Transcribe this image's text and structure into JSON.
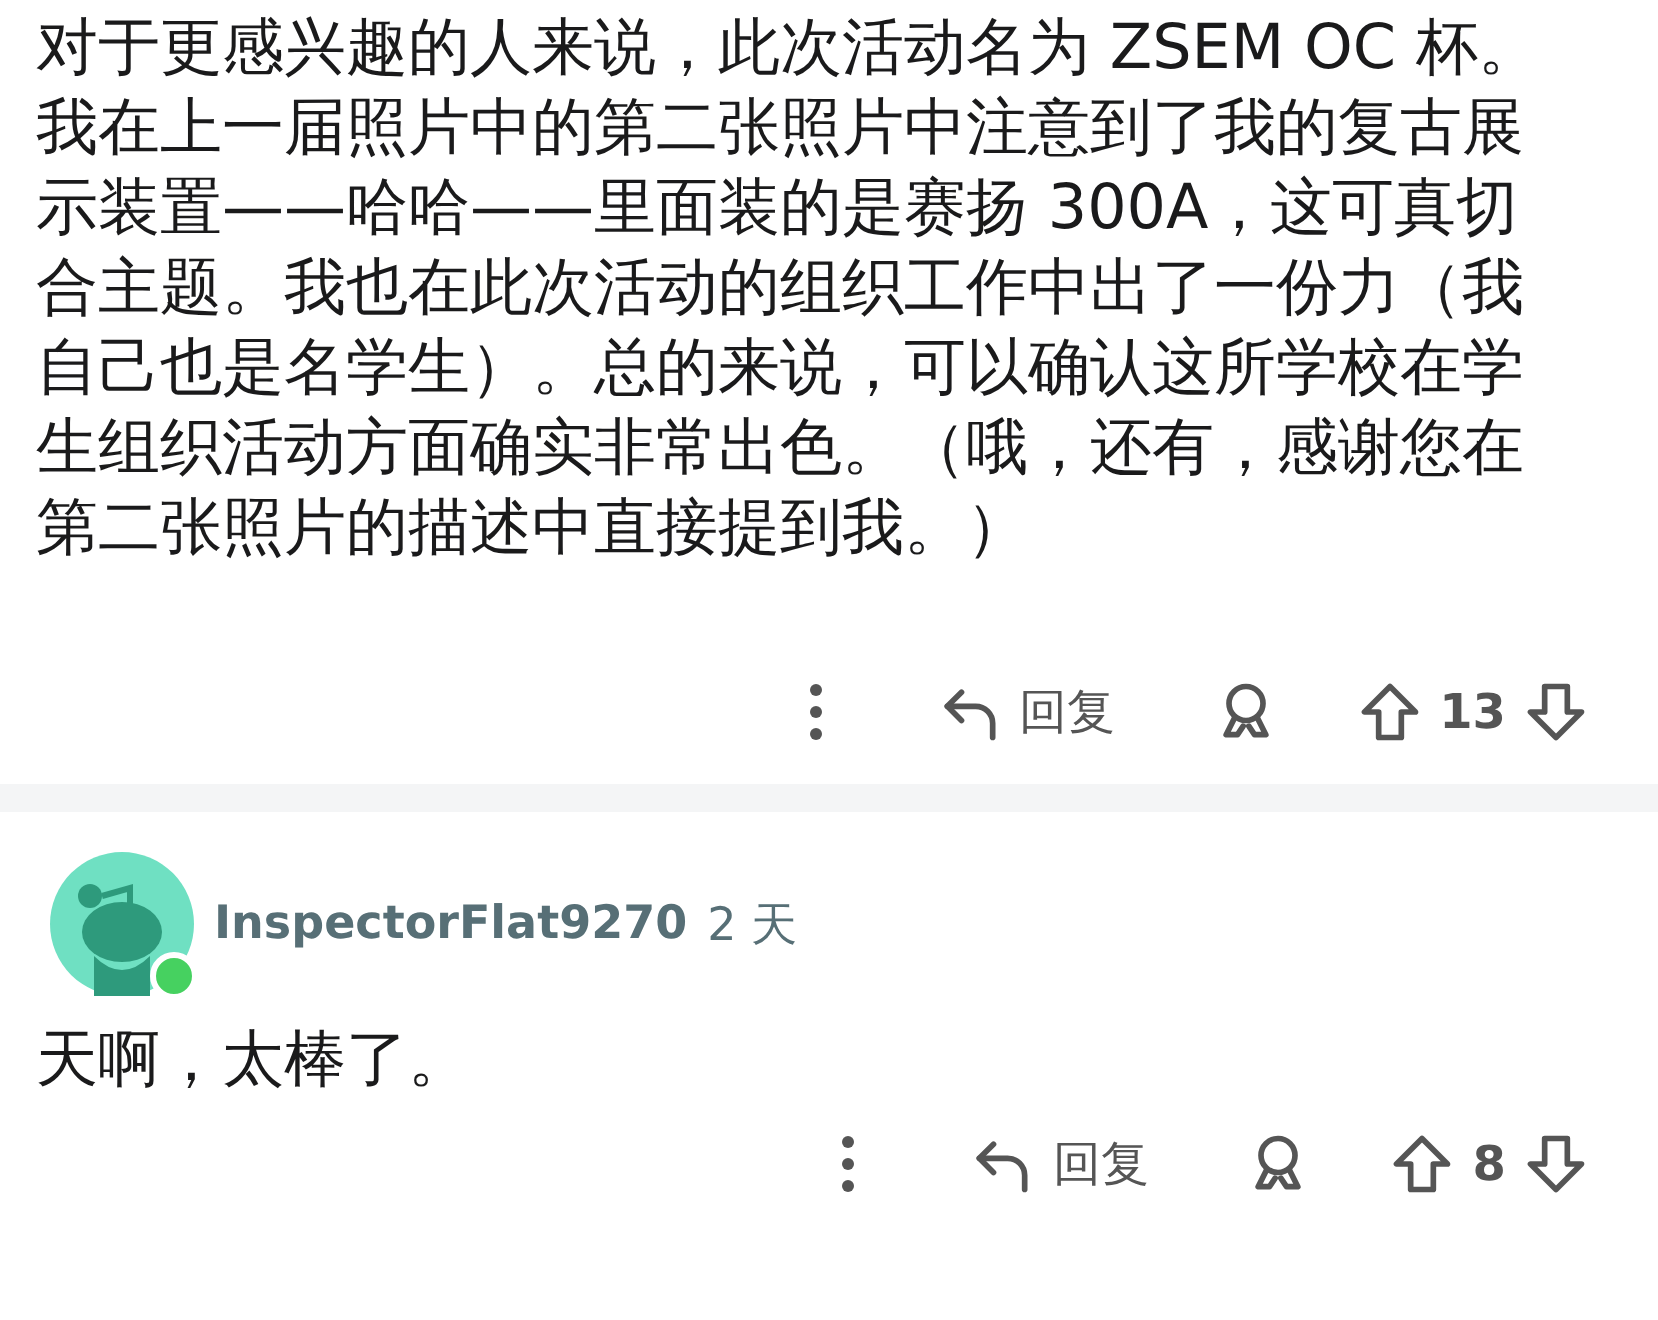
{
  "comments": [
    {
      "body": "对于更感兴趣的人来说，此次活动名为 ZSEM OC 杯。我在上一届照片中的第二张照片中注意到了我的复古展示装置——哈哈——里面装的是赛扬 300A，这可真切合主题。我也在此次活动的组织工作中出了一份力（我自己也是名学生）。总的来说，可以确认这所学校在学生组织活动方面确实非常出色。（哦，还有，感谢您在第二张照片的描述中直接提到我。）",
      "reply": "回复",
      "votes": "13"
    },
    {
      "author": {
        "name": "InspectorFlat9270",
        "time": "2 天",
        "online": true
      },
      "body": "天啊，太棒了。",
      "reply": "回复",
      "votes": "8"
    }
  ]
}
